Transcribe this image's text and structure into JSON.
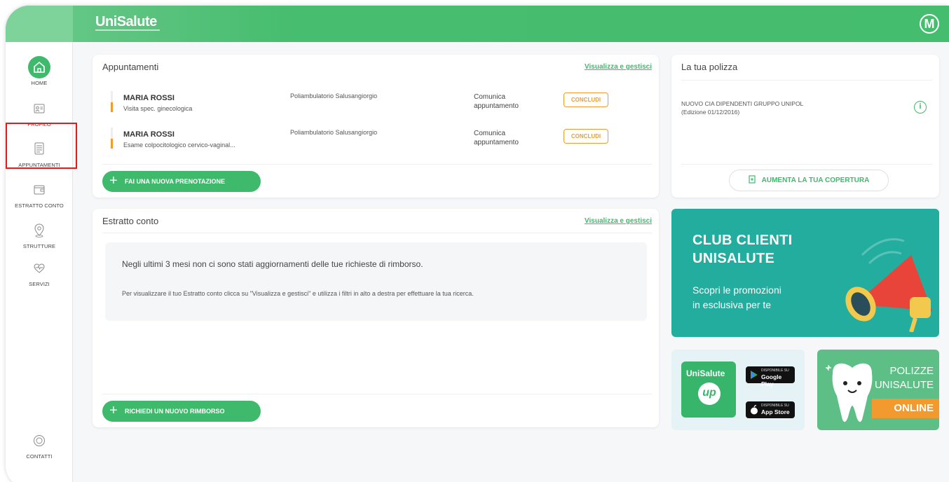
{
  "header": {
    "logo": "UniSalute",
    "avatar_initial": "M"
  },
  "sidebar": {
    "items": [
      {
        "label": "HOME",
        "icon": "home-icon"
      },
      {
        "label": "PROFILO",
        "icon": "profile-card-icon"
      },
      {
        "label": "APPUNTAMENTI",
        "icon": "calendar-icon"
      },
      {
        "label": "ESTRATTO CONTO",
        "icon": "wallet-icon"
      },
      {
        "label": "STRUTTURE",
        "icon": "location-pin-icon"
      },
      {
        "label": "SERVIZI",
        "icon": "heart-icon"
      },
      {
        "label": "CONTATTI",
        "icon": "contact-icon"
      }
    ]
  },
  "appuntamenti": {
    "title": "Appuntamenti",
    "link": "Visualizza e gestisci",
    "rows": [
      {
        "name": "MARIA ROSSI",
        "desc": "Visita spec. ginecologica",
        "place": "Poliambulatorio Salusangiorgio",
        "action_line1": "Comunica",
        "action_line2": "appuntamento",
        "button": "CONCLUDI"
      },
      {
        "name": "MARIA ROSSI",
        "desc": "Esame colpocitologico cervico-vaginal...",
        "place": "Poliambulatorio Salusangiorgio",
        "action_line1": "Comunica",
        "action_line2": "appuntamento",
        "button": "CONCLUDI"
      }
    ],
    "new_button": "FAI UNA NUOVA PRENOTAZIONE"
  },
  "polizza": {
    "title": "La tua polizza",
    "line1": "NUOVO CIA DIPENDENTI GRUPPO UNIPOL",
    "line2": "(Edizione 01/12/2016)",
    "button": "AUMENTA LA TUA COPERTURA"
  },
  "estratto": {
    "title": "Estratto conto",
    "link": "Visualizza e gestisci",
    "empty_title": "Negli ultimi 3 mesi non ci sono stati aggiornamenti delle tue richieste di rimborso.",
    "empty_text": "Per visualizzare il tuo Estratto conto clicca su \"Visualizza e gestisci\" e utilizza i filtri in alto a destra per effettuare la tua ricerca.",
    "button": "RICHIEDI UN NUOVO RIMBORSO"
  },
  "promo_club": {
    "title_line1": "CLUB CLIENTI",
    "title_line2": "UNISALUTE",
    "sub_line1": "Scopri le promozioni",
    "sub_line2": "in esclusiva per te"
  },
  "promo_app": {
    "tile_name": "UniSalute",
    "tile_mark": "up",
    "google_small": "DISPONIBILE SU",
    "google_big": "Google Play",
    "apple_small": "DISPONIBILE SU",
    "apple_big": "App Store"
  },
  "promo_polizze": {
    "line1": "POLIZZE",
    "line2": "UNISALUTE",
    "badge": "ONLINE"
  },
  "colors": {
    "brand_green": "#3fb96b",
    "accent_orange": "#f39a2e",
    "highlight_red": "#e21b1b",
    "club_teal": "#23ad9f"
  }
}
